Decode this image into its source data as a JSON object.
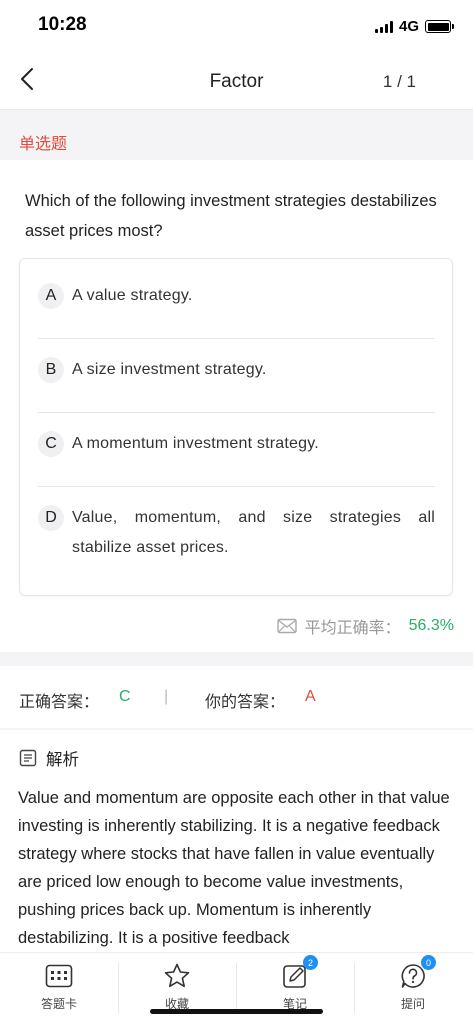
{
  "status": {
    "time": "10:28",
    "network": "4G"
  },
  "nav": {
    "title": "Factor",
    "counter": "1 / 1"
  },
  "question": {
    "type": "单选题",
    "text": "Which of the following investment strategies destabilizes asset prices most?",
    "options": [
      {
        "letter": "A",
        "text": "A value strategy."
      },
      {
        "letter": "B",
        "text": "A size investment strategy."
      },
      {
        "letter": "C",
        "text": "A momentum investment strategy."
      },
      {
        "letter": "D",
        "text": "Value, momentum, and size strategies all stabilize asset prices."
      }
    ]
  },
  "accuracy": {
    "label": "平均正确率：",
    "value": "56.3%"
  },
  "answers": {
    "correct_label": "正确答案：",
    "correct_value": "C",
    "divider": "|",
    "mine_label": "你的答案：",
    "mine_value": "A"
  },
  "analysis": {
    "title": "解析",
    "text": "Value and momentum are opposite each other in that value investing is inherently stabilizing. It is a negative feedback strategy where stocks that have fallen in value eventually are priced low enough to become value investments, pushing prices back up. Momentum is inherently destabilizing. It is a positive feedback"
  },
  "tabbar": {
    "items": [
      {
        "label": "答题卡",
        "icon": "answer-sheet-icon"
      },
      {
        "label": "收藏",
        "icon": "star-icon"
      },
      {
        "label": "笔记",
        "icon": "note-icon",
        "badge": "2"
      },
      {
        "label": "提问",
        "icon": "question-icon",
        "badge": "0"
      }
    ]
  },
  "colors": {
    "accent_red": "#e24c3d",
    "accent_green": "#2aae67",
    "badge_blue": "#1f8ff2"
  }
}
